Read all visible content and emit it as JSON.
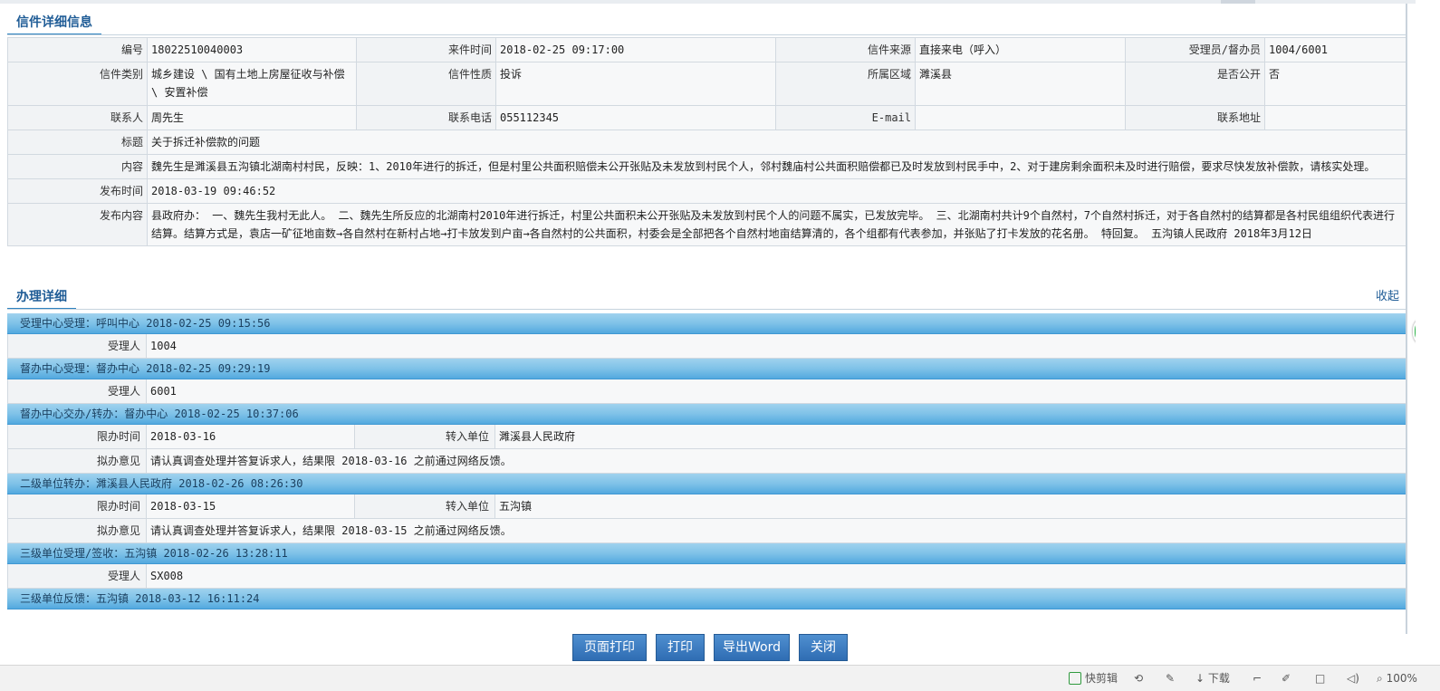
{
  "detail": {
    "title": "信件详细信息",
    "rows": {
      "bianhao_l": "编号",
      "bianhao_v": "18022510040003",
      "laijian_l": "来件时间",
      "laijian_v": "2018-02-25 09:17:00",
      "laiyuan_l": "信件来源",
      "laiyuan_v": "直接来电（呼入）",
      "shouli_l": "受理员/督办员",
      "shouli_v": "1004/6001",
      "leibie_l": "信件类别",
      "leibie_v": "城乡建设 \\ 国有土地上房屋征收与补偿 \\ 安置补偿",
      "xingzhi_l": "信件性质",
      "xingzhi_v": "投诉",
      "quyu_l": "所属区域",
      "quyu_v": "濉溪县",
      "gongkai_l": "是否公开",
      "gongkai_v": "否",
      "lianxiren_l": "联系人",
      "lianxiren_v": "周先生",
      "dianhua_l": "联系电话",
      "dianhua_v": "055112345",
      "email_l": "E-mail",
      "email_v": "",
      "dizhi_l": "联系地址",
      "dizhi_v": "",
      "biaoti_l": "标题",
      "biaoti_v": "关于拆迁补偿款的问题",
      "neirong_l": "内容",
      "neirong_v": "魏先生是濉溪县五沟镇北湖南村村民，反映：1、2010年进行的拆迁，但是村里公共面积赔偿未公开张贴及未发放到村民个人，邻村魏庙村公共面积赔偿都已及时发放到村民手中，2、对于建房剩余面积未及时进行赔偿，要求尽快发放补偿款，请核实处理。",
      "fabushijian_l": "发布时间",
      "fabushijian_v": "2018-03-19 09:46:52",
      "fabuneirong_l": "发布内容",
      "fabuneirong_v": "县政府办： 一、魏先生我村无此人。 二、魏先生所反应的北湖南村2010年进行拆迁，村里公共面积未公开张贴及未发放到村民个人的问题不属实，已发放完毕。 三、北湖南村共计9个自然村，7个自然村拆迁，对于各自然村的结算都是各村民组组织代表进行结算。结算方式是，袁店一矿征地亩数→各自然村在新村占地→打卡放发到户亩→各自然村的公共面积，村委会是全部把各个自然村地亩结算清的，各个组都有代表参加，并张贴了打卡发放的花名册。 特回复。 五沟镇人民政府 2018年3月12日"
    }
  },
  "process": {
    "title": "办理详细",
    "collapse": "收起",
    "steps": [
      {
        "header": "受理中心受理：呼叫中心 2018-02-25 09:15:56",
        "l1": "受理人",
        "v1": "1004"
      },
      {
        "header": "督办中心受理：督办中心 2018-02-25 09:29:19",
        "l1": "受理人",
        "v1": "6001"
      },
      {
        "header": "督办中心交办/转办：督办中心 2018-02-25 10:37:06",
        "l1": "限办时间",
        "v1": "2018-03-16",
        "l2": "转入单位",
        "v2": "濉溪县人民政府",
        "l3": "拟办意见",
        "v3": "请认真调查处理并答复诉求人，结果限 2018-03-16 之前通过网络反馈。"
      },
      {
        "header": "二级单位转办：濉溪县人民政府 2018-02-26 08:26:30",
        "l1": "限办时间",
        "v1": "2018-03-15",
        "l2": "转入单位",
        "v2": "五沟镇",
        "l3": "拟办意见",
        "v3": "请认真调查处理并答复诉求人，结果限 2018-03-15 之前通过网络反馈。"
      },
      {
        "header": "三级单位受理/签收：五沟镇 2018-02-26 13:28:11",
        "l1": "受理人",
        "v1": "SX008"
      },
      {
        "header": "三级单位反馈：五沟镇 2018-03-12 16:11:24"
      }
    ]
  },
  "buttons": {
    "page_print": "页面打印",
    "print": "打印",
    "export_word": "导出Word",
    "close": "关闭"
  },
  "status": {
    "kuaijianji": "快剪辑",
    "download": "下载",
    "zoom": "100%"
  }
}
